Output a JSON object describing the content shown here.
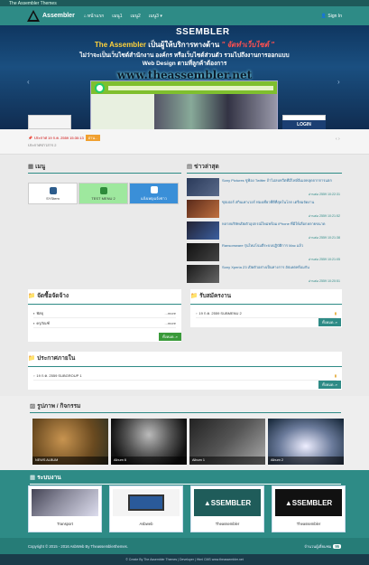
{
  "topbar": {
    "title": "The Assembler Themes"
  },
  "navbar": {
    "brand": "Assembler",
    "items": [
      {
        "label": "หน้าแรก",
        "icon": "home-icon"
      },
      {
        "label": "เมนู1"
      },
      {
        "label": "เมนู2"
      },
      {
        "label": "เมนู3 ▾"
      }
    ],
    "signin": "Sign In"
  },
  "hero": {
    "brand": "SSEMBLER",
    "line1_a": "The Assembler",
    "line1_b": "เป็นผู้ให้บริการทางด้าน",
    "line1_c": "\" จัดทำเว็บไซต์ \"",
    "line2_a": "ไม่ว่าจะเป็นเว็บไซต์สำนักงาน องค์กร หรือเว็บไซต์ส่วนตัว รวมไปถึงงานการออกแบบ",
    "line2_b": "Web Design ตามที่ลูกค้าต้องการ",
    "url": "www.theassembler.net",
    "login": "LOGIN"
  },
  "ticker": {
    "headline": "ประกาศ 19 ก.ค. 2559 15:30:13",
    "more": "อ่าน...",
    "line2": "ประกาศข่าวสาร 2"
  },
  "menu": {
    "title": "เมนู",
    "tiles": [
      {
        "label": "SYStem",
        "color": "#ffffff"
      },
      {
        "label": "TEST MENU 2",
        "color": "#9ee89e"
      },
      {
        "label": "แจ้งเหตุ/แจ้งข่าว",
        "color": "#3a8fd8"
      }
    ]
  },
  "news": {
    "title": "ข่าวล่าสุด",
    "items": [
      {
        "text": "Sony Pictures ขู่ฟ้อง Twitter ถ้าไม่ลบทวีตที่มีไฟล์อีเมลหลุดจากการแฮก",
        "date": "อ่านต่อ 2559 10:22:31"
      },
      {
        "text": "ซุปเปอร์ สกินเพาเวอร์ ท่องเที่ยวที่ดีที่สุดในโลก เตรียมจัดงาน",
        "date": "อ่านต่อ 2559 10:21:52"
      },
      {
        "text": "หลายบริษัทเปิดตัวอุปกรณ์ใหม่พร้อม iPhone ที่มีให้เลือกหลายขนาด",
        "date": "อ่านต่อ 2559 10:21:38"
      },
      {
        "text": "Ransomware รุ่นใหม่โจมตีระบบปฏิบัติการ Mac แล้ว",
        "date": "อ่านต่อ 2559 10:21:05"
      },
      {
        "text": "Sony Xperia Z3 เปิดตัวอย่างเป็นทางการ อัปเดตพร้อมกัน",
        "date": "อ่านต่อ 2559 10:20:51"
      }
    ]
  },
  "procure": {
    "title": "จัดซื้อจัดจ้าง",
    "rows": [
      {
        "label": "พัสดุ",
        "more": "...more"
      },
      {
        "label": "ครุภัณฑ์",
        "more": "...more"
      }
    ],
    "all": "ทั้งหมด..»"
  },
  "jobs": {
    "title": "รับสมัครงาน",
    "rows": [
      {
        "label": "19 ก.ค. 2559 SUBMENU 2"
      }
    ],
    "all": "ทั้งหมด..»"
  },
  "internal": {
    "title": "ประกาศภายใน",
    "rows": [
      {
        "label": "19 ก.ค. 2559 SUBGROUP 1"
      }
    ],
    "all": "ทั้งหมด..»"
  },
  "gallery": {
    "title": "รูปภาพ / กิจกรรม",
    "items": [
      {
        "caption": "NEWS ALBUM"
      },
      {
        "caption": "Album 6"
      },
      {
        "caption": "Album 1"
      },
      {
        "caption": "Album 2"
      }
    ]
  },
  "portfolio": {
    "title": "ระบบงาน",
    "items": [
      {
        "label": "Transport"
      },
      {
        "label": "Asbweb"
      },
      {
        "label": "Theassembler"
      },
      {
        "label": "Theassembler"
      }
    ],
    "logo_text": "SSEMBLER"
  },
  "footer": {
    "copyright": "Copyright © 2015 - 2016 AsbWeb By Theassemblerthemes.",
    "visitors_label": "จำนวนผู้เยี่ยมชม",
    "visitors": "95",
    "credit": "© Create By The Assembler Themes | Developer | Html CMS www.theassembler.net"
  },
  "colors": {
    "teal": "#2e8b86",
    "dark_teal": "#1e5a5a",
    "accent": "#f0a030"
  }
}
